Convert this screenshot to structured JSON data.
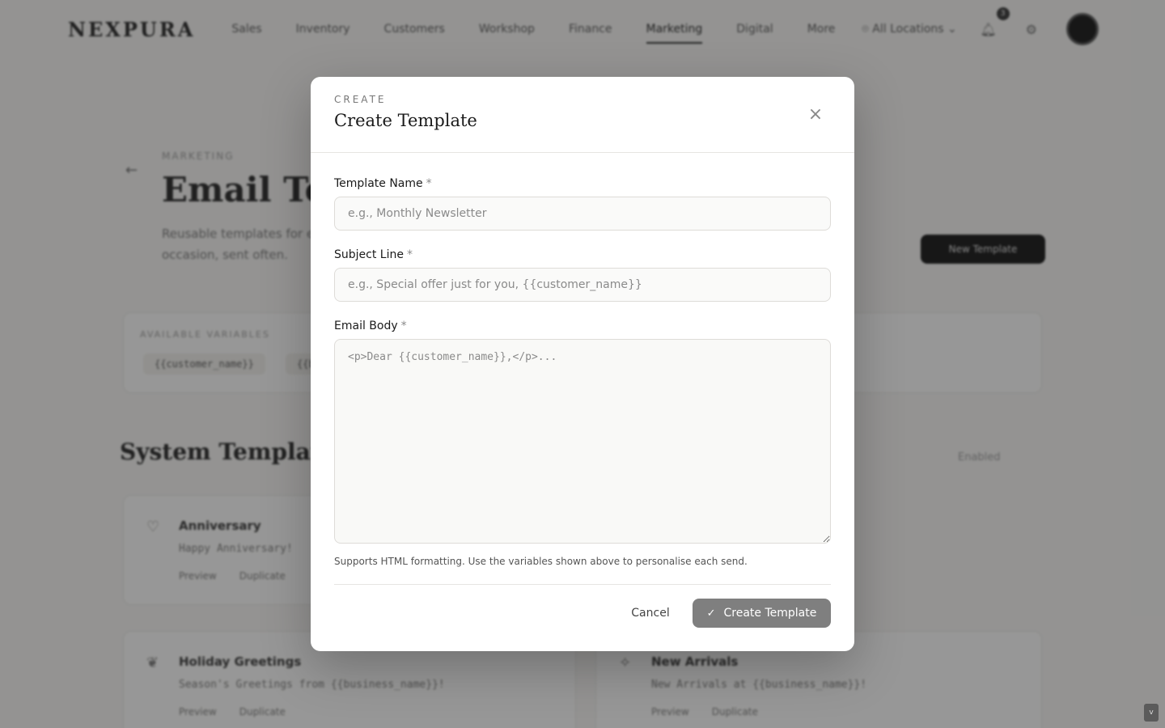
{
  "nav": {
    "brand": "NEXPURA",
    "items": [
      "Sales",
      "Inventory",
      "Customers",
      "Workshop",
      "Finance",
      "Marketing",
      "Digital",
      "More"
    ],
    "location": "All Locations",
    "notification_count": "3"
  },
  "page": {
    "eyebrow": "MARKETING",
    "title": "Email Templates",
    "description": "Reusable templates for every occasion, sent often.",
    "new_button": "New Template",
    "vars_title": "AVAILABLE VARIABLES",
    "variables": [
      "{{customer_name}}",
      "{{business_name}}"
    ],
    "system_title": "System Templates",
    "system_count": "Enabled"
  },
  "cards": [
    {
      "name": "Anniversary",
      "subject": "Happy Anniversary!",
      "preview": "Preview",
      "duplicate": "Duplicate"
    },
    {
      "name": "Holiday Greetings",
      "subject": "Season's Greetings from {{business_name}}!",
      "preview": "Preview",
      "duplicate": "Duplicate"
    },
    {
      "name": "New Arrivals",
      "subject": "New Arrivals at {{business_name}}!",
      "preview": "Preview",
      "duplicate": "Duplicate"
    }
  ],
  "modal": {
    "eyebrow": "CREATE",
    "title": "Create Template",
    "close_icon": "close-icon",
    "fields": {
      "name": {
        "label": "Template Name",
        "required": "*",
        "placeholder": "e.g., Monthly Newsletter",
        "value": ""
      },
      "subject": {
        "label": "Subject Line",
        "required": "*",
        "placeholder": "e.g., Special offer just for you, {{customer_name}}",
        "value": ""
      },
      "body": {
        "label": "Email Body",
        "required": "*",
        "placeholder": "<p>Dear {{customer_name}},</p>...",
        "value": ""
      }
    },
    "help_text": "Supports HTML formatting. Use the variables shown above to personalise each send.",
    "cancel_label": "Cancel",
    "create_label": "Create Template"
  },
  "colors": {
    "primary_button": "#7f7f7f",
    "overlay": "rgba(30,30,30,0.45)"
  }
}
